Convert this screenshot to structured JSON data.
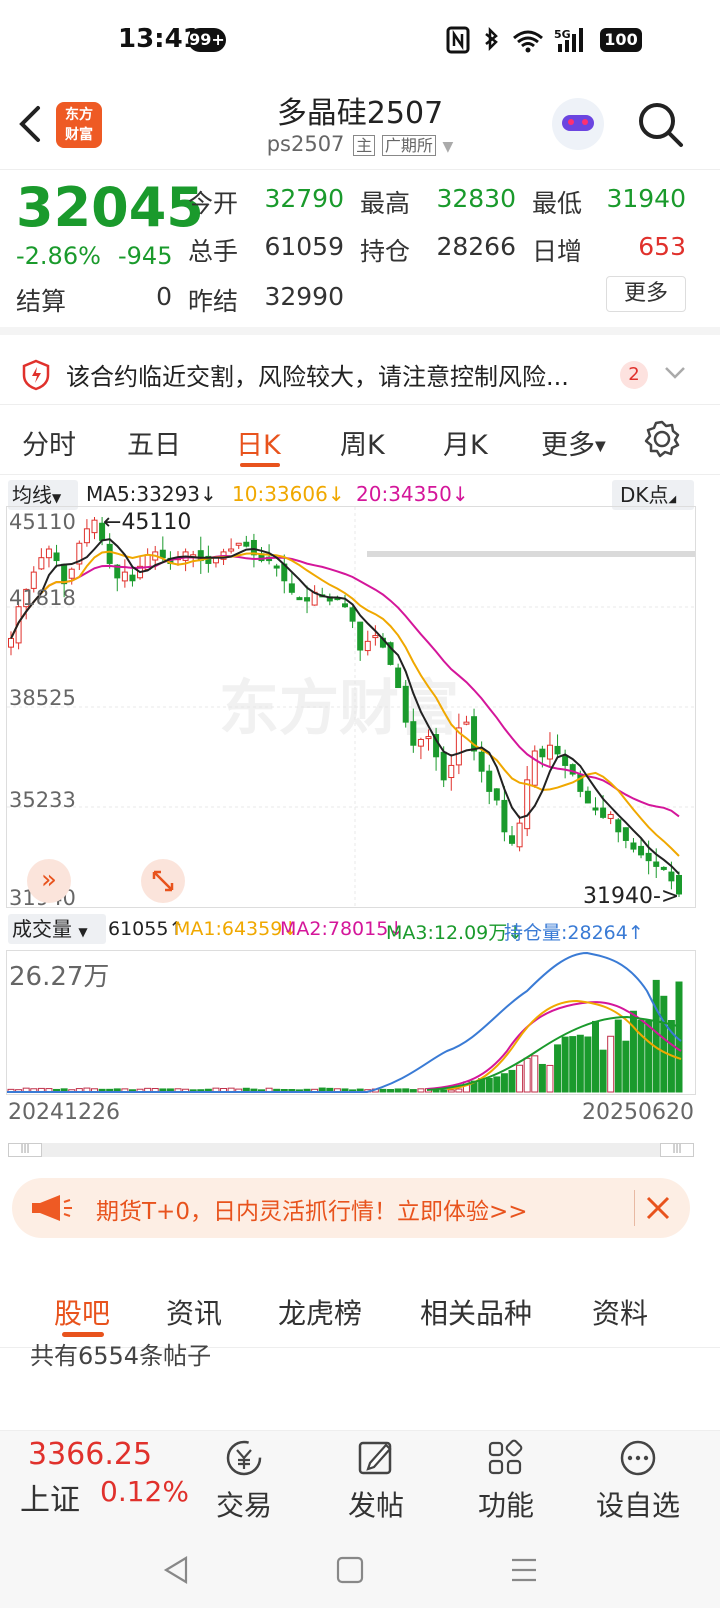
{
  "status": {
    "time": "13:41",
    "badge": "99+",
    "signal": "5G",
    "battery": "100"
  },
  "header": {
    "logo_line1": "东方",
    "logo_line2": "财富",
    "title": "多晶硅2507",
    "code": "ps2507",
    "tag_main": "主",
    "tag_exchange": "广期所"
  },
  "quote": {
    "price": "32045",
    "change_pct": "-2.86%",
    "change": "-945",
    "settle_label": "结算",
    "settle": "0",
    "open_label": "今开",
    "open": "32790",
    "high_label": "最高",
    "high": "32830",
    "low_label": "最低",
    "low": "31940",
    "volume_label": "总手",
    "volume": "61059",
    "oi_label": "持仓",
    "oi": "28266",
    "daily_inc_label": "日增",
    "daily_inc": "653",
    "prev_settle_label": "昨结",
    "prev_settle": "32990",
    "more_label": "更多"
  },
  "notice": {
    "text": "该合约临近交割，风险较大，请注意控制风险...",
    "count": "2"
  },
  "tabs": [
    "分时",
    "五日",
    "日K",
    "周K",
    "月K",
    "更多"
  ],
  "active_tab": 2,
  "ma_bar": {
    "selector": "均线",
    "ma5": "MA5:33293",
    "ma10": "10:33606",
    "ma20": "20:34350",
    "dk": "DK点"
  },
  "price_axis": [
    "45110",
    "41818",
    "38525",
    "35233",
    "31940"
  ],
  "price_annotations": {
    "high": "45110",
    "low": "31940->"
  },
  "volume_bar": {
    "selector": "成交量",
    "vol": "61055",
    "ma1": "MA1:64359",
    "ma2": "MA2:78015",
    "ma3": "MA3:12.09万",
    "oi": "持仓量:28264"
  },
  "volume_axis_top": "26.27万",
  "date_range": {
    "start": "20241226",
    "end": "20250620"
  },
  "ad": {
    "text": "期货T+0，日内灵活抓行情！立即体验>>"
  },
  "bottom_tabs": [
    "股吧",
    "资讯",
    "龙虎榜",
    "相关品种",
    "资料"
  ],
  "posts_count": "共有6554条帖子",
  "footer": {
    "index_value": "3366.25",
    "index_name": "上证",
    "index_change": "0.12%",
    "trade": "交易",
    "post": "发帖",
    "func": "功能",
    "watch": "设自选"
  },
  "watermark": "东方财富",
  "colors": {
    "accent": "#e8531d",
    "up": "#e0312c",
    "down": "#1a9a2c",
    "ma5": "#222222",
    "ma10": "#f0a800",
    "ma20": "#d4169a"
  },
  "chart_data": {
    "type": "candlestick",
    "ylim": [
      31940,
      45110
    ],
    "x_range": [
      "20241226",
      "20250620"
    ],
    "close": [
      40900,
      42000,
      42600,
      43200,
      43700,
      44000,
      43600,
      42800,
      43300,
      44200,
      44700,
      45000,
      44300,
      43500,
      43000,
      43200,
      42900,
      43400,
      43800,
      43900,
      43700,
      43500,
      43700,
      43900,
      43800,
      43600,
      43500,
      43700,
      43900,
      44000,
      44200,
      44100,
      43800,
      43600,
      43600,
      43400,
      42900,
      42500,
      42300,
      42200,
      42500,
      42400,
      42200,
      42300,
      42000,
      41500,
      40500,
      40800,
      41000,
      40600,
      40000,
      39200,
      38000,
      37200,
      37400,
      37500,
      36800,
      36000,
      36500,
      37800,
      38000,
      37000,
      36300,
      35600,
      35300,
      34200,
      33800,
      34500,
      36000,
      37000,
      36800,
      37200,
      36900,
      36500,
      36200,
      35600,
      35200,
      35000,
      34700,
      34800,
      34200,
      33900,
      33600,
      33400,
      33200,
      33000,
      32950,
      32500,
      32045
    ],
    "ma5_end": 33293,
    "ma10_end": 33606,
    "ma20_end": 34350
  }
}
